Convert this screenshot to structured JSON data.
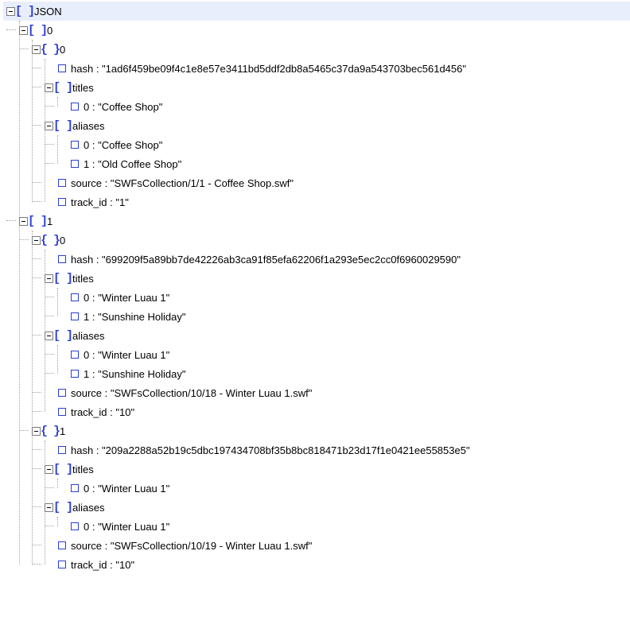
{
  "root": {
    "label": "JSON",
    "items": [
      {
        "key": "0",
        "objects": [
          {
            "key": "0",
            "hash": "\"1ad6f459be09f4c1e8e57e3411bd5ddf2db8a5465c37da9a543703bec561d456\"",
            "titles_label": "titles",
            "titles": [
              {
                "key": "0",
                "value": "\"Coffee Shop\""
              }
            ],
            "aliases_label": "aliases",
            "aliases": [
              {
                "key": "0",
                "value": "\"Coffee Shop\""
              },
              {
                "key": "1",
                "value": "\"Old Coffee Shop\""
              }
            ],
            "source": "\"SWFsCollection/1/1 - Coffee Shop.swf\"",
            "track_id": "\"1\""
          }
        ]
      },
      {
        "key": "1",
        "objects": [
          {
            "key": "0",
            "hash": "\"699209f5a89bb7de42226ab3ca91f85efa62206f1a293e5ec2cc0f6960029590\"",
            "titles_label": "titles",
            "titles": [
              {
                "key": "0",
                "value": "\"Winter Luau 1\""
              },
              {
                "key": "1",
                "value": "\"Sunshine Holiday\""
              }
            ],
            "aliases_label": "aliases",
            "aliases": [
              {
                "key": "0",
                "value": "\"Winter Luau 1\""
              },
              {
                "key": "1",
                "value": "\"Sunshine Holiday\""
              }
            ],
            "source": "\"SWFsCollection/10/18 - Winter Luau 1.swf\"",
            "track_id": "\"10\""
          },
          {
            "key": "1",
            "hash": "\"209a2288a52b19c5dbc197434708bf35b8bc818471b23d17f1e0421ee55853e5\"",
            "titles_label": "titles",
            "titles": [
              {
                "key": "0",
                "value": "\"Winter Luau 1\""
              }
            ],
            "aliases_label": "aliases",
            "aliases": [
              {
                "key": "0",
                "value": "\"Winter Luau 1\""
              }
            ],
            "source": "\"SWFsCollection/10/19 - Winter Luau 1.swf\"",
            "track_id": "\"10\""
          }
        ]
      }
    ]
  },
  "labels": {
    "hash": "hash",
    "source": "source",
    "track_id": "track_id"
  },
  "glyphs": {
    "array": "[ ]",
    "object": "{ }"
  }
}
